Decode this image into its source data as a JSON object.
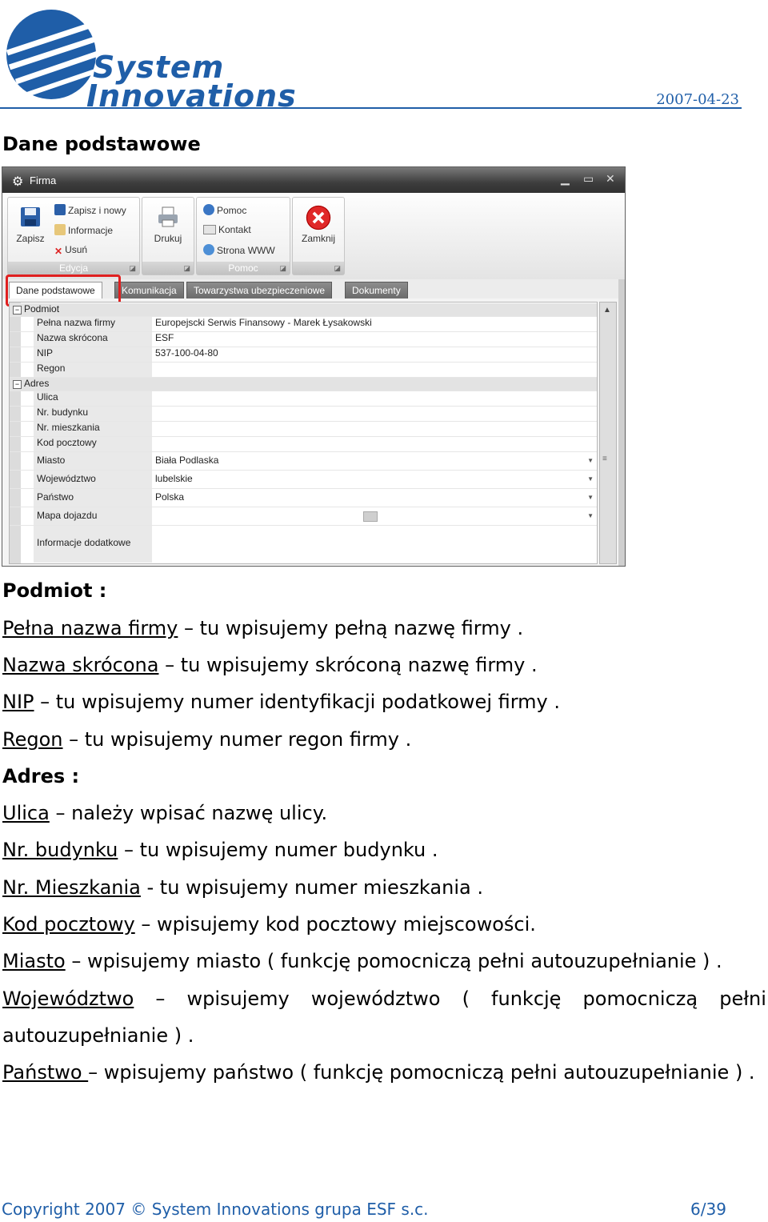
{
  "header": {
    "logo_line1": "System",
    "logo_line2": "Innovations",
    "date": "2007-04-23"
  },
  "section_title": "Dane podstawowe",
  "window": {
    "title": "Firma",
    "ribbon": {
      "edycja": {
        "caption": "Edycja",
        "save": "Zapisz",
        "save_new": "Zapisz i nowy",
        "info": "Informacje",
        "delete": "Usuń"
      },
      "print": {
        "label": "Drukuj"
      },
      "pomoc": {
        "caption": "Pomoc",
        "help": "Pomoc",
        "contact": "Kontakt",
        "www": "Strona WWW"
      },
      "close": {
        "label": "Zamknij"
      }
    },
    "tabs": [
      "Dane podstawowe",
      "Komunikacja",
      "Towarzystwa ubezpieczeniowe",
      "Dokumenty"
    ],
    "grid": {
      "cat_podmiot": "Podmiot",
      "cat_adres": "Adres",
      "rows": [
        {
          "label": "Pełna nazwa firmy",
          "value": "Europejscki Serwis Finansowy - Marek Łysakowski"
        },
        {
          "label": "Nazwa skrócona",
          "value": "ESF"
        },
        {
          "label": "NIP",
          "value": "537-100-04-80"
        },
        {
          "label": "Regon",
          "value": ""
        },
        {
          "label": "Ulica",
          "value": ""
        },
        {
          "label": "Nr. budynku",
          "value": ""
        },
        {
          "label": "Nr. mieszkania",
          "value": ""
        },
        {
          "label": "Kod pocztowy",
          "value": ""
        },
        {
          "label": "Miasto",
          "value": "Biała Podlaska"
        },
        {
          "label": "Województwo",
          "value": "lubelskie"
        },
        {
          "label": "Państwo",
          "value": "Polska"
        },
        {
          "label": "Mapa dojazdu",
          "value": ""
        },
        {
          "label": "Informacje dodatkowe",
          "value": ""
        }
      ]
    }
  },
  "body": {
    "podmiot_heading": "Podmiot :",
    "adres_heading": "Adres :",
    "lines": [
      {
        "term": "Pełna nazwa firmy",
        "desc": " – tu wpisujemy pełną nazwę firmy ."
      },
      {
        "term": "Nazwa skrócona",
        "desc": " – tu wpisujemy skróconą nazwę firmy ."
      },
      {
        "term": "NIP",
        "desc": " – tu wpisujemy numer identyfikacji podatkowej firmy ."
      },
      {
        "term": "Regon",
        "desc": " – tu wpisujemy numer regon firmy ."
      },
      {
        "term": "Ulica",
        "desc": " – należy wpisać nazwę ulicy."
      },
      {
        "term": "Nr. budynku",
        "desc": " – tu wpisujemy numer budynku ."
      },
      {
        "term": "Nr. Mieszkania",
        "desc": " - tu wpisujemy numer mieszkania ."
      },
      {
        "term": "Kod pocztowy",
        "desc": " – wpisujemy kod pocztowy miejscowości."
      },
      {
        "term": "Miasto",
        "desc": " – wpisujemy miasto ( funkcję pomocniczą pełni autouzupełnianie ) ."
      },
      {
        "term": "Państwo ",
        "desc": "– wpisujemy państwo ( funkcję pomocniczą pełni autouzupełnianie ) ."
      }
    ],
    "wojewodztwo": {
      "term": "Województwo",
      "words": [
        "–",
        "wpisujemy",
        "województwo",
        "(",
        "funkcję",
        "pomocniczą",
        "pełni"
      ],
      "cont": "autouzupełnianie ) ."
    }
  },
  "footer": {
    "copyright": "Copyright 2007 © System Innovations grupa ESF s.c.",
    "page": "6/39"
  },
  "colors": {
    "accent": "#1f5ea8",
    "highlight": "#e02020"
  }
}
